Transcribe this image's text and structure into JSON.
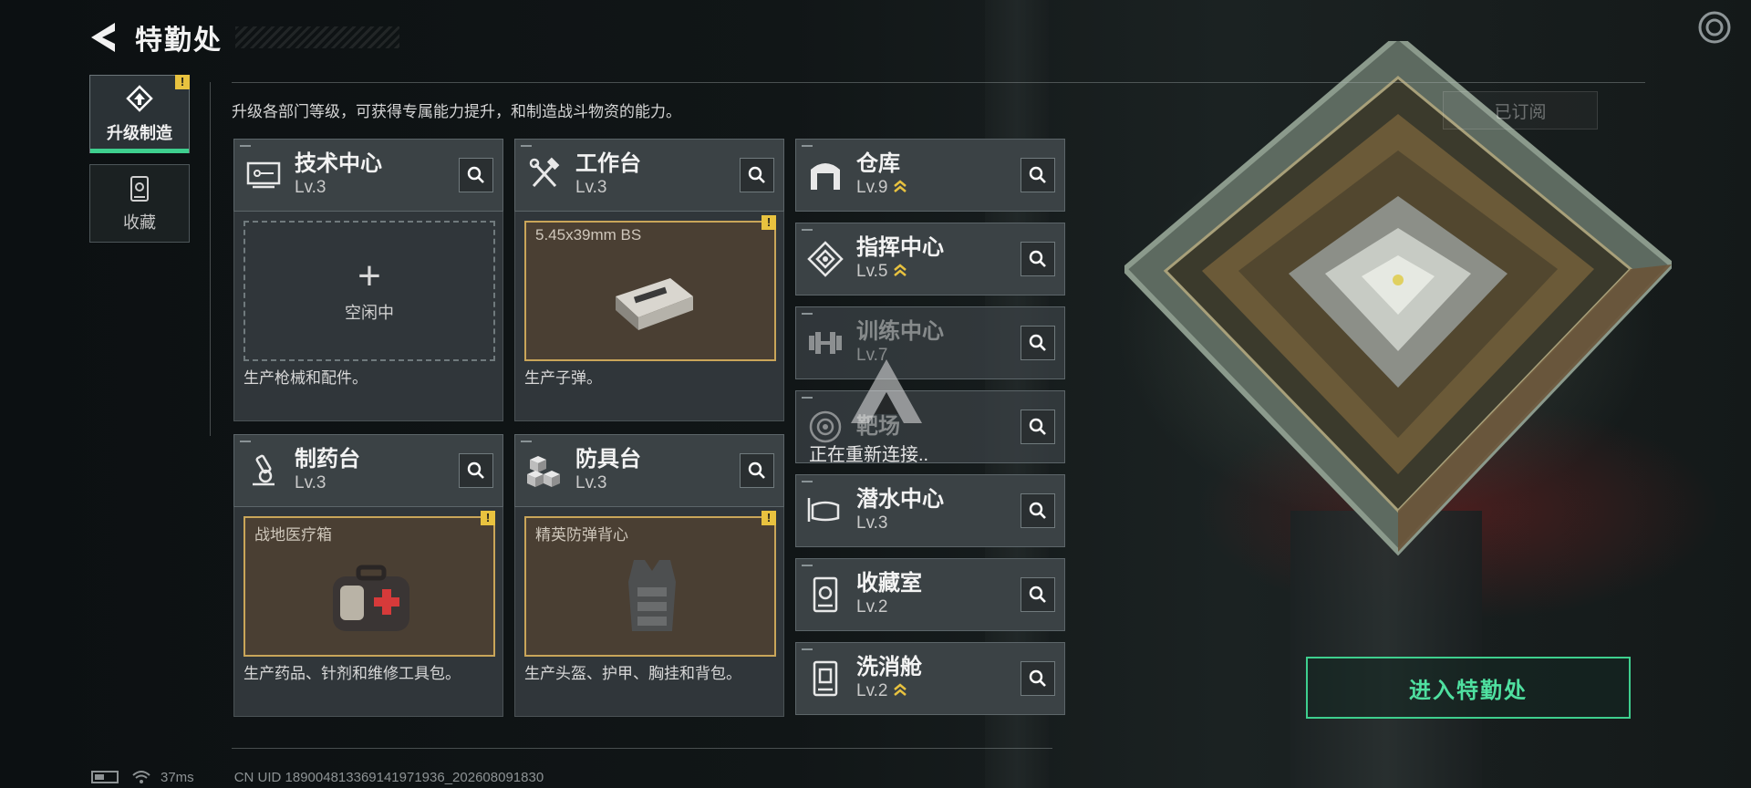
{
  "header": {
    "title": "特勤处"
  },
  "sidebar": {
    "tabs": [
      {
        "label": "升级制造",
        "active": true
      },
      {
        "label": "收藏",
        "active": false
      }
    ],
    "badge": "!"
  },
  "subtitle": "升级各部门等级，可获得专属能力提升，和制造战斗物资的能力。",
  "subscribed_label": "已订阅",
  "facilities": {
    "tech": {
      "name": "技术中心",
      "level": "Lv.3",
      "slot_status": "空闲中",
      "desc": "生产枪械和配件。"
    },
    "workbench": {
      "name": "工作台",
      "level": "Lv.3",
      "product": "5.45x39mm BS",
      "desc": "生产子弹。"
    },
    "pharmacy": {
      "name": "制药台",
      "level": "Lv.3",
      "product": "战地医疗箱",
      "desc": "生产药品、针剂和维修工具包。"
    },
    "armor": {
      "name": "防具台",
      "level": "Lv.3",
      "product": "精英防弹背心",
      "desc": "生产头盔、护甲、胸挂和背包。"
    }
  },
  "side_facilities": [
    {
      "name": "仓库",
      "level": "Lv.9",
      "upgradable": true
    },
    {
      "name": "指挥中心",
      "level": "Lv.5",
      "upgradable": true
    },
    {
      "name": "训练中心",
      "level": "Lv.7",
      "upgradable": false
    },
    {
      "name": "靶场",
      "level": "",
      "upgradable": false
    },
    {
      "name": "潜水中心",
      "level": "Lv.3",
      "upgradable": false
    },
    {
      "name": "收藏室",
      "level": "Lv.2",
      "upgradable": false
    },
    {
      "name": "洗消舱",
      "level": "Lv.2",
      "upgradable": true
    }
  ],
  "overlay": {
    "reconnect_text": "正在重新连接.."
  },
  "enter_button": "进入特勤处",
  "status": {
    "ping": "37ms",
    "uid": "CN UID 1890048133691419719​36_202608091830"
  },
  "colors": {
    "accent": "#3ecf8e",
    "warning": "#e8c23f",
    "product_border": "#c9a559",
    "upgrade_chevron": "#e8c23f"
  }
}
